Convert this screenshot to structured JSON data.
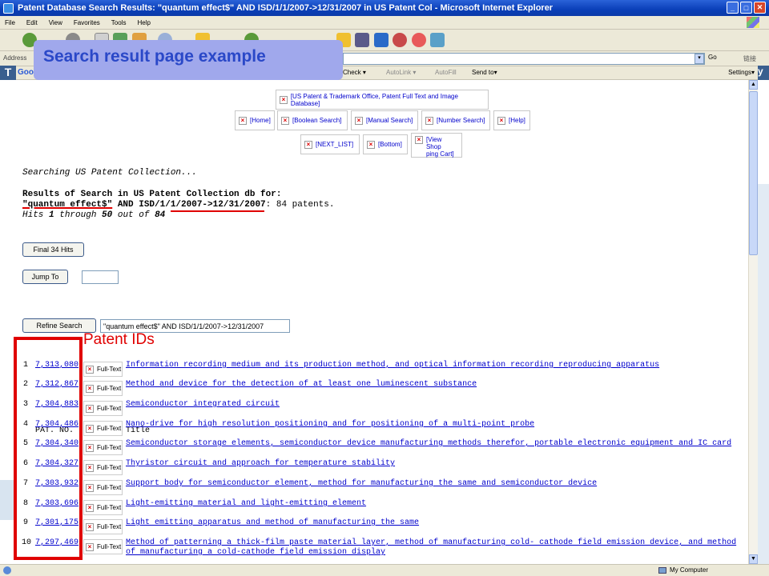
{
  "window": {
    "title": "Patent Database Search Results: \"quantum effect$\" AND ISD/1/1/2007->12/31/2007 in US Patent Col - Microsoft Internet Explorer",
    "controls": [
      "_",
      "□",
      "✕"
    ]
  },
  "menu": [
    "File",
    "Edit",
    "View",
    "Favorites",
    "Tools",
    "Help"
  ],
  "address": {
    "label": "Address",
    "go_label": "Go",
    "links_label": "链接"
  },
  "google_toolbar": {
    "logo": "Goo",
    "check": "Check ▾",
    "autolink": "AutoLink ▾",
    "autofill": "AutoFill",
    "sendto": "Send to▾",
    "settings": "Settings▾"
  },
  "annotation": {
    "title": "Search result page example",
    "patent_ids_label": "Patent IDs"
  },
  "nav": {
    "banner": "[US Patent & Trademark Office, Patent Full Text and Image Database]",
    "home": "[Home]",
    "boolean": "[Boolean Search]",
    "manual": "[Manual Search]",
    "number": "[Number Search]",
    "help": "[Help]",
    "next_list": "[NEXT_LIST]",
    "bottom": "[Bottom]",
    "cart_line1": "[View Shop",
    "cart_line2": "ping Cart]"
  },
  "search": {
    "searching": "Searching US Patent Collection...",
    "results_heading": "Results of Search in US Patent Collection db for:",
    "query_term": "\"quantum effect$\"",
    "query_and": " AND ISD/1/1/2007->12/31/2007",
    "query_count": ": 84 patents.",
    "hits_a": "Hits ",
    "hits_from": "1",
    "hits_mid": " through ",
    "hits_to": "50",
    "hits_of": " out of ",
    "hits_total": "84"
  },
  "buttons": {
    "final": "Final 34 Hits",
    "jump": "Jump To",
    "refine": "Refine Search"
  },
  "refine_value": "\"quantum effect$\" AND ISD/1/1/2007->12/31/2007",
  "table": {
    "col_patno": "PAT. NO.",
    "col_title": "Title",
    "fulltext_label": "Full-Text",
    "rows": [
      {
        "num": "1",
        "id": "7,313,080",
        "title": "Information recording medium and its production method, and optical information recording reproducing apparatus"
      },
      {
        "num": "2",
        "id": "7,312,867",
        "title": "Method and device for the detection of at least one luminescent substance"
      },
      {
        "num": "3",
        "id": "7,304,883",
        "title": "Semiconductor integrated circuit"
      },
      {
        "num": "4",
        "id": "7,304,486",
        "title": "Nano-drive for high resolution positioning and for positioning of a multi-point probe"
      },
      {
        "num": "5",
        "id": "7,304,340",
        "title": "Semiconductor storage elements, semiconductor device manufacturing methods therefor, portable electronic equipment and IC card"
      },
      {
        "num": "6",
        "id": "7,304,327",
        "title": "Thyristor circuit and approach for temperature stability"
      },
      {
        "num": "7",
        "id": "7,303,932",
        "title": "Support body for semiconductor element, method for manufacturing the same and semiconductor device"
      },
      {
        "num": "8",
        "id": "7,303,696",
        "title": "Light-emitting material and light-emitting element"
      },
      {
        "num": "9",
        "id": "7,301,175",
        "title": "Light emitting apparatus and method of manufacturing the same"
      },
      {
        "num": "10",
        "id": "7,297,469",
        "title": "Method of patterning a thick-film paste material layer, method of manufacturing cold- cathode field emission device, and method of manufacturing a cold-cathode field emission display"
      }
    ]
  },
  "status": {
    "zone": "My Computer"
  }
}
